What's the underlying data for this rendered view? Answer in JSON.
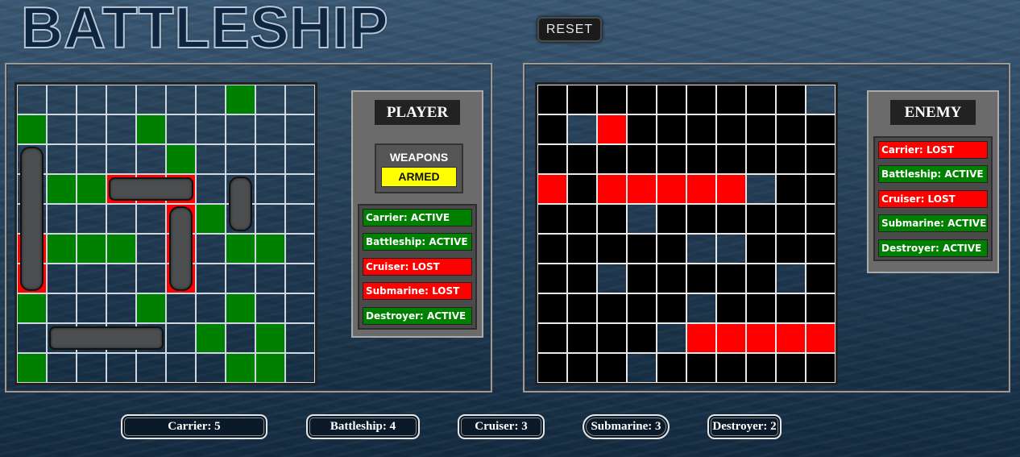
{
  "title": "BATTLESHIP",
  "reset_label": "RESET",
  "colors": {
    "hit": "#ff0000",
    "miss": "#008000",
    "unknown": "#000000",
    "armed": "#ffff00"
  },
  "player": {
    "title": "PLAYER",
    "weapons_label": "WEAPONS",
    "weapons_status": "ARMED",
    "fleet": [
      {
        "text": "Carrier: ACTIVE",
        "state": "active"
      },
      {
        "text": "Battleship: ACTIVE",
        "state": "active"
      },
      {
        "text": "Cruiser: LOST",
        "state": "lost"
      },
      {
        "text": "Submarine: LOST",
        "state": "lost"
      },
      {
        "text": "Destroyer: ACTIVE",
        "state": "active"
      }
    ],
    "board_legend": "e = empty, m = miss (green), h = hit (red)",
    "board": [
      "eeeeeeemee",
      "meeemeeeee",
      "eeeeemeeee",
      "emmhhheeee",
      "eeeeehmeee",
      "hmmmehemme",
      "heeeeheeee",
      "meeemeemee",
      "eeeeeememe",
      "meeeeeemme"
    ],
    "ships": [
      {
        "name": "Carrier",
        "row": 2,
        "col": 0,
        "length": 5,
        "orientation": "vertical"
      },
      {
        "name": "Battleship",
        "row": 8,
        "col": 1,
        "length": 4,
        "orientation": "horizontal"
      },
      {
        "name": "Cruiser",
        "row": 3,
        "col": 3,
        "length": 3,
        "orientation": "horizontal"
      },
      {
        "name": "Submarine",
        "row": 4,
        "col": 5,
        "length": 3,
        "orientation": "vertical"
      },
      {
        "name": "Destroyer",
        "row": 3,
        "col": 7,
        "length": 2,
        "orientation": "vertical"
      }
    ]
  },
  "enemy": {
    "title": "ENEMY",
    "fleet": [
      {
        "text": "Carrier: LOST",
        "state": "lost"
      },
      {
        "text": "Battleship: ACTIVE",
        "state": "active"
      },
      {
        "text": "Cruiser: LOST",
        "state": "lost"
      },
      {
        "text": "Submarine: ACTIVE",
        "state": "active"
      },
      {
        "text": "Destroyer: ACTIVE",
        "state": "active"
      }
    ],
    "board_legend": "u = unknown (black), o = open water, h = hit (red)",
    "board": [
      "uuuuuuuuuo",
      "uohuuuuuuu",
      "uuuuuuuuuu",
      "huhhhhhouu",
      "uuuouuuuuu",
      "uuuuuoouuu",
      "uuouuuuuou",
      "uuuuuouuuu",
      "uuuuohhhhh",
      "uuuouuuuuu"
    ]
  },
  "ship_legend": [
    {
      "text": "Carrier: 5"
    },
    {
      "text": "Battleship: 4"
    },
    {
      "text": "Cruiser: 3"
    },
    {
      "text": "Submarine: 3"
    },
    {
      "text": "Destroyer: 2"
    }
  ]
}
